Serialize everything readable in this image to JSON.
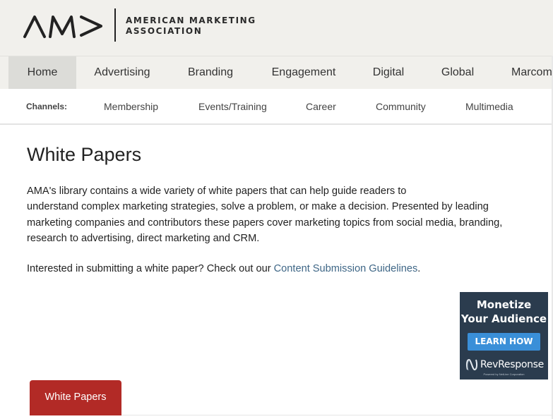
{
  "header": {
    "logo_mark": "AMA",
    "org_name_line1": "AMERICAN MARKETING",
    "org_name_line2": "ASSOCIATION"
  },
  "nav": {
    "items": [
      {
        "label": "Home",
        "active": true
      },
      {
        "label": "Advertising",
        "active": false
      },
      {
        "label": "Branding",
        "active": false
      },
      {
        "label": "Engagement",
        "active": false
      },
      {
        "label": "Digital",
        "active": false
      },
      {
        "label": "Global",
        "active": false
      },
      {
        "label": "Marcom",
        "active": false
      }
    ]
  },
  "channels": {
    "label": "Channels:",
    "items": [
      "Membership",
      "Events/Training",
      "Career",
      "Community",
      "Multimedia"
    ]
  },
  "main": {
    "title": "White Papers",
    "intro_lines": [
      "AMA's library contains a wide variety of white papers that can help guide readers to",
      "understand complex marketing strategies, solve a problem, or make a decision.  Presented by leading",
      "marketing companies and contributors these papers cover marketing topics from social media, branding,",
      "research to advertising, direct marketing and CRM."
    ],
    "submit_prefix": "Interested in submitting a white paper?  Check out our ",
    "submit_link": "Content Submission Guidelines",
    "submit_suffix": "."
  },
  "ad": {
    "headline_line1": "Monetize",
    "headline_line2": "Your Audience",
    "button_label": "LEARN HOW",
    "brand": "RevResponse",
    "brand_sub": "Powered by NetLine Corporation",
    "logo_icon": "revresponse-n-icon"
  },
  "tabs": [
    {
      "label": "White Papers",
      "active": true
    }
  ],
  "colors": {
    "header_bg": "#f1f0ec",
    "nav_active_bg": "#dcdcd8",
    "link": "#3e6686",
    "tab_active": "#b22a26",
    "ad_bg": "#2b3c4e",
    "ad_button": "#3a8fd8"
  }
}
